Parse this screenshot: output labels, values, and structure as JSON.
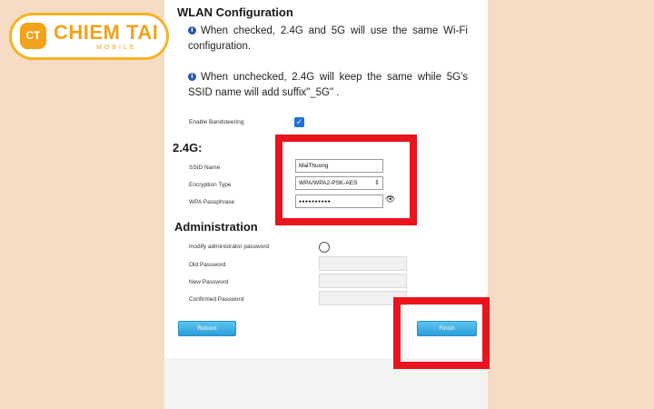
{
  "logo": {
    "badge": "CT",
    "name": "CHIEM TAI",
    "sub": "MOBILE"
  },
  "wlan": {
    "title": "WLAN Configuration",
    "note_checked": "When checked, 2.4G and 5G will use the same Wi-Fi configuration.",
    "note_unchecked": "When unchecked, 2.4G will keep the same while 5G's SSID name will add suffix\"_5G\" .",
    "band_steering": {
      "label": "Enable Bandsteering",
      "checked": true
    }
  },
  "band24": {
    "heading": "2.4G:",
    "ssid_label": "SSID Name",
    "ssid_value": "MaiThuong",
    "encryption_label": "Encryption Type",
    "encryption_value": "WPA/WPA2-PSK-AES",
    "passphrase_label": "WPA Passphrase",
    "passphrase_value": "●●●●●●●●●●"
  },
  "admin": {
    "heading": "Administration",
    "modify_label": "modify administrator password",
    "modify_checked": false,
    "old_label": "Old Password",
    "new_label": "New Password",
    "confirm_label": "Confirmed Password"
  },
  "buttons": {
    "reboot": "Reboot",
    "finish": "Finish"
  },
  "colors": {
    "highlight": "#e8141e",
    "button": "#2a9edb",
    "logo": "#f3a21c",
    "background": "#f6dcc4"
  },
  "icons": {
    "info": "info-icon",
    "check": "checkmark-icon",
    "eye": "eye-icon",
    "select": "chevron-icon"
  }
}
